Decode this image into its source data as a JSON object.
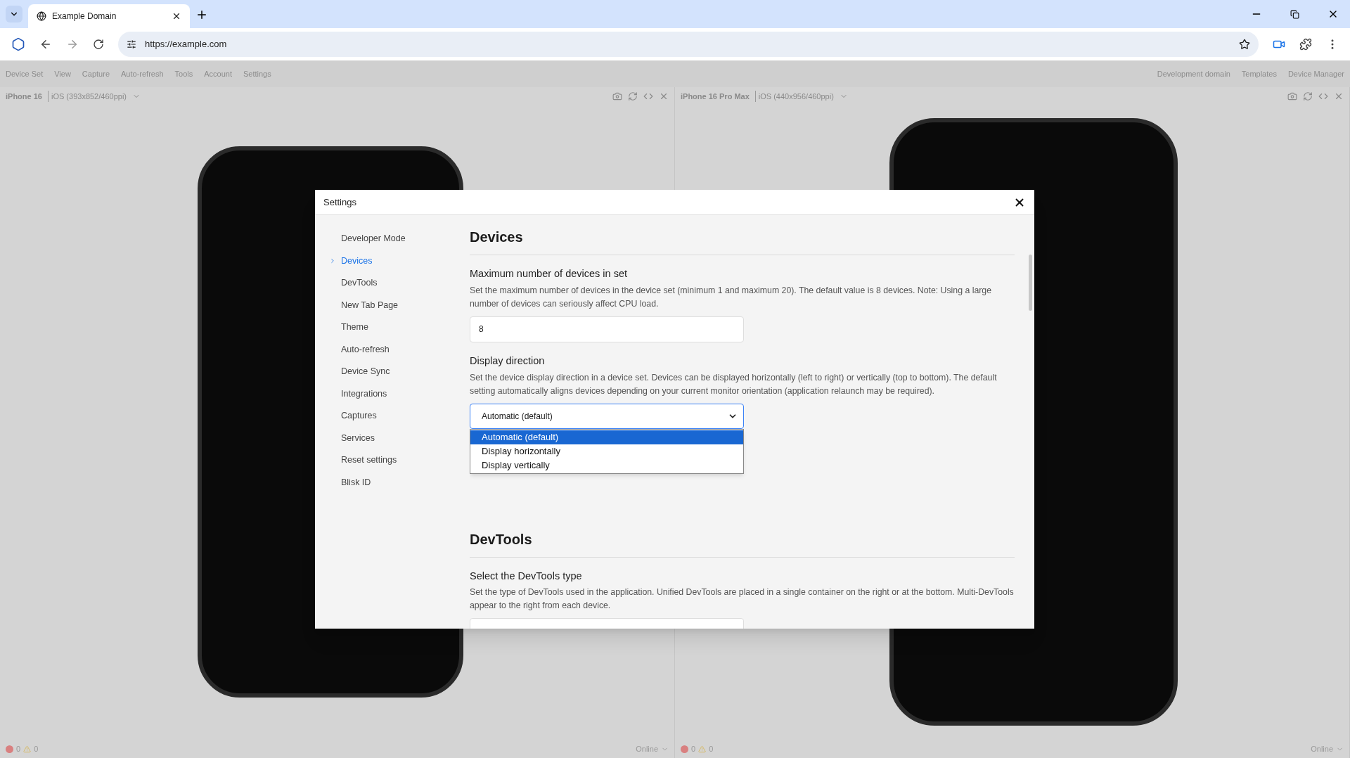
{
  "browser": {
    "tab_title": "Example Domain",
    "url": "https://example.com"
  },
  "menu": {
    "left": [
      "Device Set",
      "View",
      "Capture",
      "Auto-refresh",
      "Tools",
      "Account",
      "Settings"
    ],
    "right": [
      "Development domain",
      "Templates",
      "Device Manager"
    ]
  },
  "devices": [
    {
      "name": "iPhone 16",
      "info": "iOS (393x852/460ppi)",
      "errors": "0",
      "warnings": "0",
      "network": "Online"
    },
    {
      "name": "iPhone 16 Pro Max",
      "info": "iOS (440x956/460ppi)",
      "errors": "0",
      "warnings": "0",
      "network": "Online"
    }
  ],
  "dialog": {
    "title": "Settings",
    "nav": [
      {
        "label": "Developer Mode",
        "selected": false
      },
      {
        "label": "Devices",
        "selected": true
      },
      {
        "label": "DevTools",
        "selected": false
      },
      {
        "label": "New Tab Page",
        "selected": false
      },
      {
        "label": "Theme",
        "selected": false
      },
      {
        "label": "Auto-refresh",
        "selected": false
      },
      {
        "label": "Device Sync",
        "selected": false
      },
      {
        "label": "Integrations",
        "selected": false
      },
      {
        "label": "Captures",
        "selected": false
      },
      {
        "label": "Services",
        "selected": false
      },
      {
        "label": "Reset settings",
        "selected": false
      },
      {
        "label": "Blisk ID",
        "selected": false
      }
    ],
    "sections": [
      {
        "title": "Devices",
        "settings": [
          {
            "kind": "input",
            "label": "Maximum number of devices in set",
            "description": "Set the maximum number of devices in the device set (minimum 1 and maximum 20). The default value is 8 devices. Note: Using a large number of devices can seriously affect CPU load.",
            "value": "8"
          },
          {
            "kind": "select",
            "label": "Display direction",
            "description": "Set the device display direction in a device set. Devices can be displayed horizontally (left to right) or vertically (top to bottom). The default setting automatically aligns devices depending on your current monitor orientation (application relaunch may be required).",
            "value": "Automatic (default)",
            "options": [
              {
                "label": "Automatic (default)",
                "selected": true
              },
              {
                "label": "Display horizontally",
                "selected": false
              },
              {
                "label": "Display vertically",
                "selected": false
              }
            ]
          }
        ]
      },
      {
        "title": "DevTools",
        "settings": [
          {
            "kind": "input",
            "label": "Select the DevTools type",
            "description": "Set the type of DevTools used in the application. Unified DevTools are placed in a single container on the right or at the bottom. Multi-DevTools appear to the right from each device."
          }
        ]
      }
    ]
  }
}
